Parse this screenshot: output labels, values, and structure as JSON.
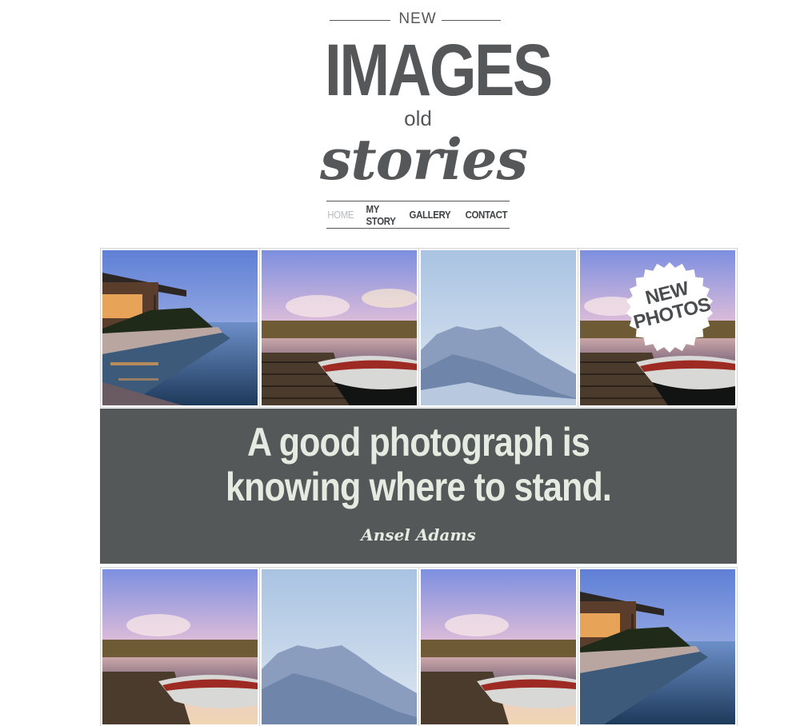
{
  "logo": {
    "new": "NEW",
    "images": "IMAGES",
    "old": "old",
    "stories": "stories"
  },
  "nav": {
    "items": [
      {
        "label": "HOME",
        "active": true
      },
      {
        "label": "MY STORY",
        "active": false
      },
      {
        "label": "GALLERY",
        "active": false
      },
      {
        "label": "CONTACT",
        "active": false
      }
    ]
  },
  "gallery": {
    "row1": [
      "pool-villa",
      "lake-dock",
      "misty-mountain",
      "lake-dock"
    ],
    "row2": [
      "lake-dock",
      "misty-mountain",
      "lake-dock",
      "pool-villa"
    ]
  },
  "badge": {
    "line1": "NEW",
    "line2": "PHOTOS"
  },
  "quote": {
    "line1": "A good photograph is",
    "line2": "knowing where to stand.",
    "author": "Ansel Adams"
  },
  "colors": {
    "text": "#555759",
    "quote_bg": "#555859",
    "quote_text": "#e6ebe1",
    "nav_active": "#b9bbbd"
  }
}
